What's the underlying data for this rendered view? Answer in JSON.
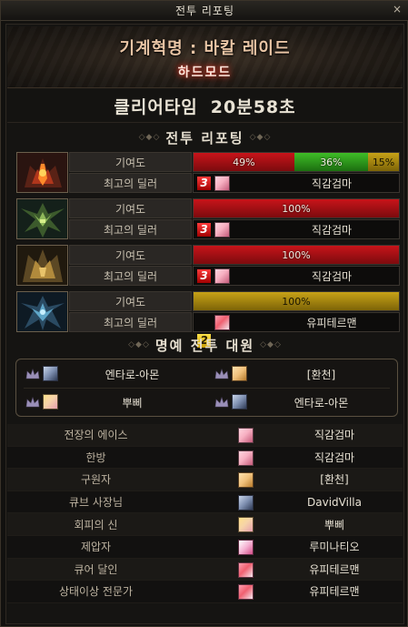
{
  "window": {
    "title": "전투 리포팅",
    "close_glyph": "×"
  },
  "banner": {
    "raid_title": "기계혁명 : 바칼 레이드",
    "mode": "하드모드"
  },
  "clear": {
    "label": "클리어타임",
    "time": "20분58초"
  },
  "sections": {
    "report": "전투 리포팅",
    "honor": "명예 전투 대원",
    "deco_left": "◇◆◇",
    "deco_right": "◇◆◇"
  },
  "row_labels": {
    "contribution": "기여도",
    "top_dealer": "최고의 딜러"
  },
  "colors": {
    "red": "#c8141a",
    "green": "#3fbd27",
    "gold": "#c7a217"
  },
  "bosses": [
    {
      "icon": "fire-dragon-portrait",
      "contribution": [
        {
          "value": "49%",
          "pct": 49,
          "color": "red"
        },
        {
          "value": "36%",
          "pct": 36,
          "color": "green"
        },
        {
          "value": "15%",
          "pct": 15,
          "color": "gold"
        }
      ],
      "dealer_rank": "3",
      "dealer_name": "직감검마"
    },
    {
      "icon": "green-dragon-portrait",
      "contribution": [
        {
          "value": "100%",
          "pct": 100,
          "color": "red"
        }
      ],
      "dealer_rank": "3",
      "dealer_name": "직감검마"
    },
    {
      "icon": "gold-dragon-portrait",
      "contribution": [
        {
          "value": "100%",
          "pct": 100,
          "color": "red"
        }
      ],
      "dealer_rank": "3",
      "dealer_name": "직감검마"
    },
    {
      "icon": "ice-dragon-portrait",
      "contribution": [
        {
          "value": "100%",
          "pct": 100,
          "color": "gold"
        }
      ],
      "dealer_rank": "2",
      "dealer_name": "유피테르맨"
    }
  ],
  "honor_members": [
    {
      "name": "엔타로-아몬",
      "face": "c"
    },
    {
      "name": "[환천]",
      "face": "b"
    },
    {
      "name": "뿌삐",
      "face": "d"
    },
    {
      "name": "엔타로-아몬",
      "face": "c"
    }
  ],
  "awards": [
    {
      "title": "전장의 에이스",
      "player": "직감검마",
      "face": "a"
    },
    {
      "title": "한방",
      "player": "직감검마",
      "face": "a"
    },
    {
      "title": "구원자",
      "player": "[환천]",
      "face": "b"
    },
    {
      "title": "큐브 사장님",
      "player": "DavidVilla",
      "face": "c"
    },
    {
      "title": "회피의 신",
      "player": "뿌삐",
      "face": "d"
    },
    {
      "title": "제압자",
      "player": "루미나티오",
      "face": "e"
    },
    {
      "title": "큐어 달인",
      "player": "유피테르맨",
      "face": "f"
    },
    {
      "title": "상태이상 전문가",
      "player": "유피테르맨",
      "face": "f"
    }
  ]
}
